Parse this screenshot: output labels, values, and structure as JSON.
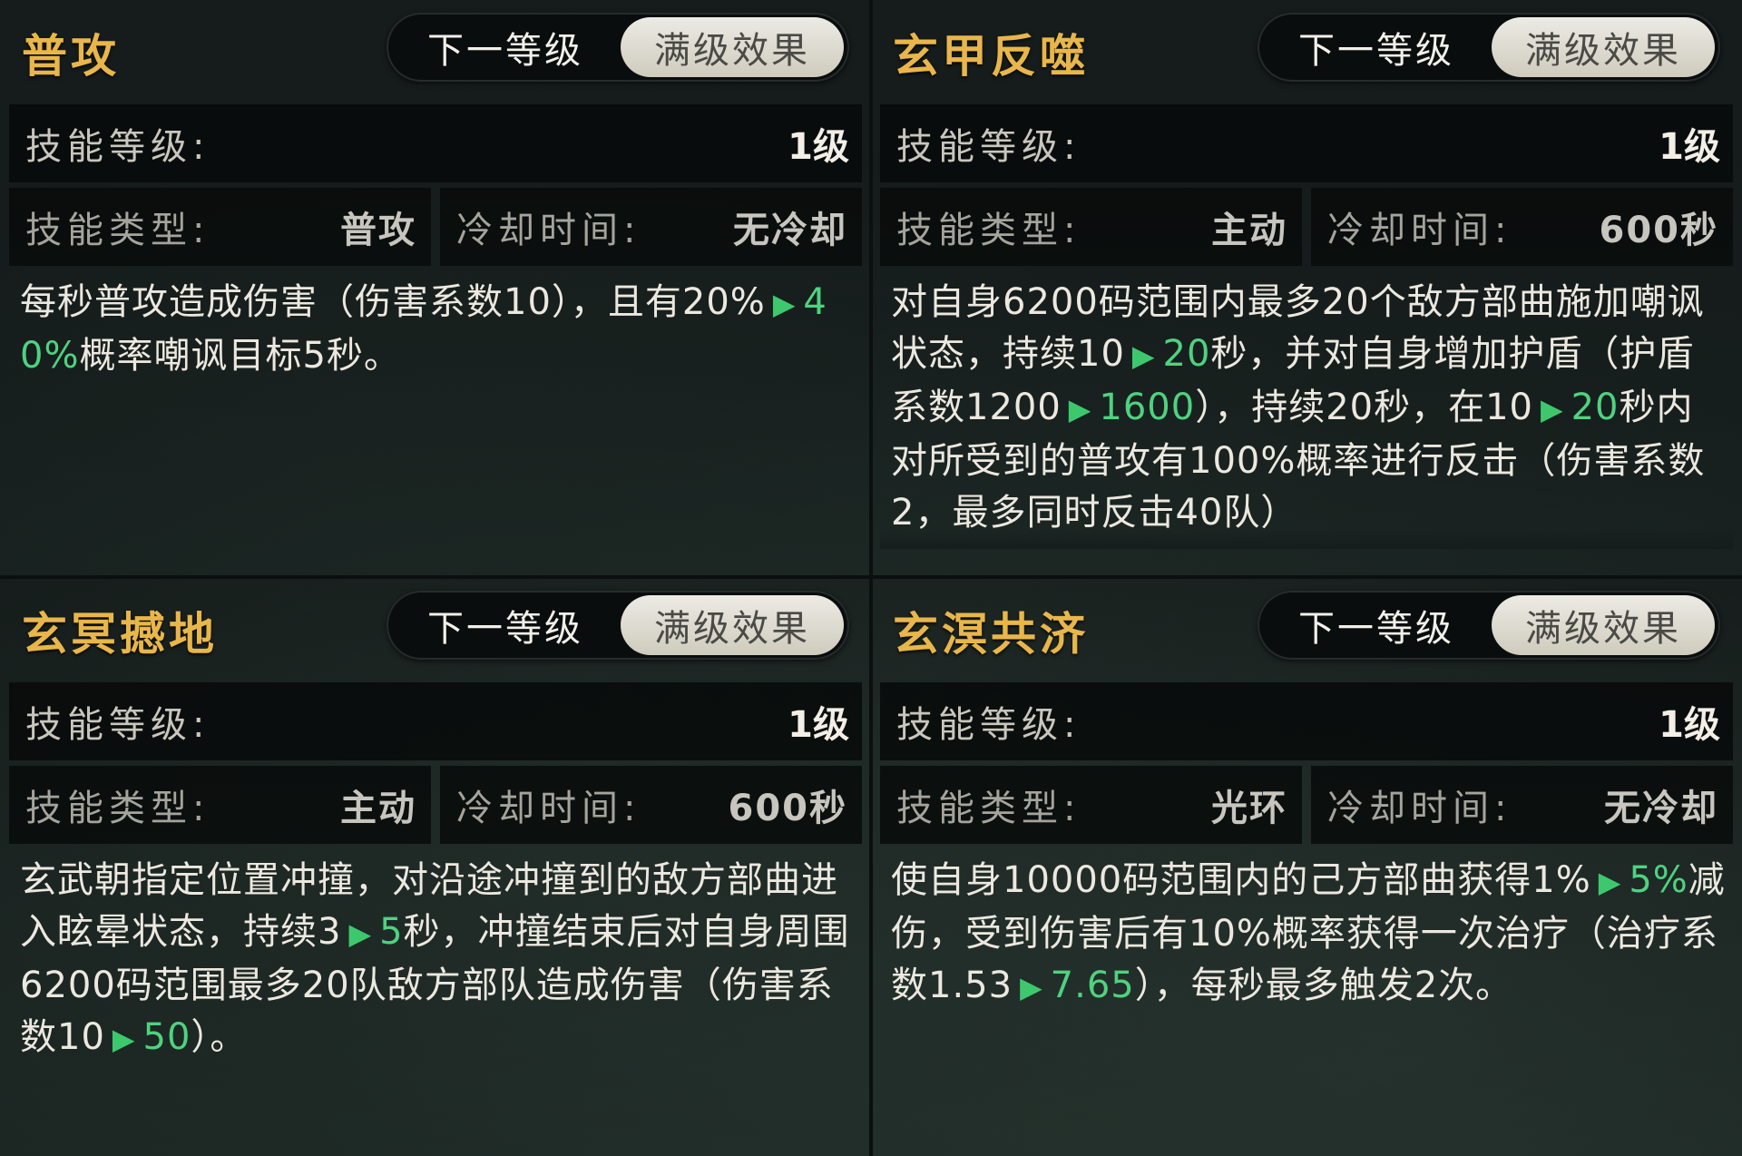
{
  "panels": [
    {
      "title": "普攻",
      "toggle": {
        "next": "下一等级",
        "max": "满级效果"
      },
      "level_label": "技能等级:",
      "level_value": "1级",
      "type_label": "技能类型:",
      "type_value": "普攻",
      "cd_label": "冷却时间:",
      "cd_value": "无冷却",
      "desc": {
        "t1": "每秒普攻造成伤害（伤害系数10），且有20%",
        "g1": "40%",
        "t2": "概率嘲讽目标5秒。"
      }
    },
    {
      "title": "玄甲反噬",
      "toggle": {
        "next": "下一等级",
        "max": "满级效果"
      },
      "level_label": "技能等级:",
      "level_value": "1级",
      "type_label": "技能类型:",
      "type_value": "主动",
      "cd_label": "冷却时间:",
      "cd_value": "600秒",
      "desc": {
        "t1": "对自身6200码范围内最多20个敌方部曲施加嘲讽状态，持续10",
        "g1": "20",
        "t2": "秒，并对自身增加护盾（护盾系数1200",
        "g2": "1600",
        "t3": "），持续20秒，在10",
        "g3": "20",
        "t4": "秒内对所受到的普攻有100%概率进行反击（伤害系数2，最多同时反击40",
        "t5": "队）"
      }
    },
    {
      "title": "玄冥撼地",
      "toggle": {
        "next": "下一等级",
        "max": "满级效果"
      },
      "level_label": "技能等级:",
      "level_value": "1级",
      "type_label": "技能类型:",
      "type_value": "主动",
      "cd_label": "冷却时间:",
      "cd_value": "600秒",
      "desc": {
        "t1": "玄武朝指定位置冲撞，对沿途冲撞到的敌方部曲进入眩晕状态，持续3",
        "g1": "5",
        "t2": "秒，冲撞结束后对自身周围6200码范围最多20队敌方部队造成伤害（伤害系数10",
        "g2": "50",
        "t3": "）。"
      }
    },
    {
      "title": "玄溟共济",
      "toggle": {
        "next": "下一等级",
        "max": "满级效果"
      },
      "level_label": "技能等级:",
      "level_value": "1级",
      "type_label": "技能类型:",
      "type_value": "光环",
      "cd_label": "冷却时间:",
      "cd_value": "无冷却",
      "desc": {
        "t1": "使自身10000码范围内的己方部曲获得1%",
        "g1": "5%",
        "t2": "减伤，受到伤害后有10%概率获得一次治疗（治疗系数1.53",
        "g2": "7.65",
        "t3": "），每秒最多触发2次。"
      }
    }
  ],
  "icons": {
    "arrow": "▶"
  },
  "colors": {
    "title": "#e8b64a",
    "highlight": "#4fd27f"
  }
}
